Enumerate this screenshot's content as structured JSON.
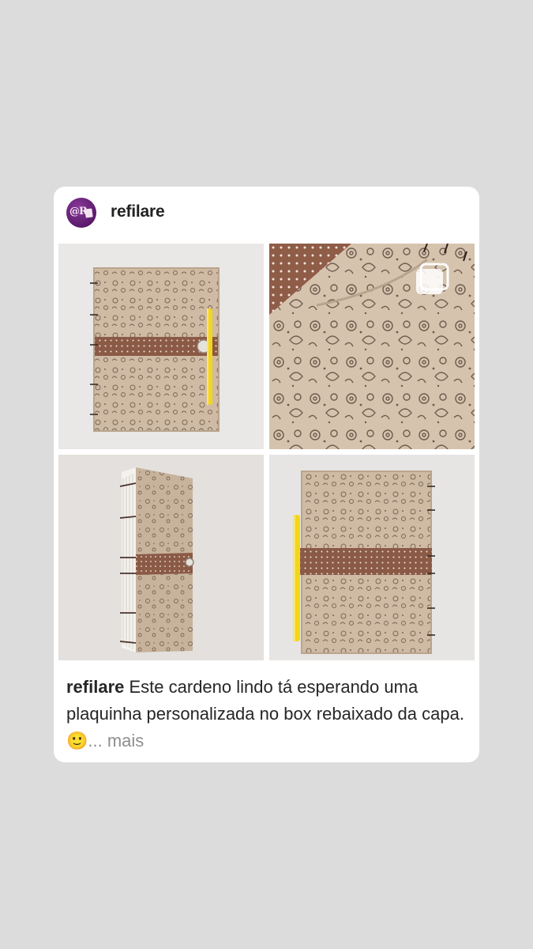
{
  "post": {
    "username": "refilare",
    "avatar_label": "@R",
    "caption_user": "refilare",
    "caption_text": " Este cardeno lindo tá esperando uma plaquinha personalizada no box rebaixado da capa. ",
    "caption_emoji": "🙂",
    "caption_more": "... mais"
  },
  "icons": {
    "multi_photo": "multiple-photos-icon"
  },
  "colors": {
    "background": "#dcdcdc",
    "card": "#ffffff",
    "fabric": "#cdb8a0",
    "strap": "#8a5a46",
    "pen": "#f2d51c"
  }
}
